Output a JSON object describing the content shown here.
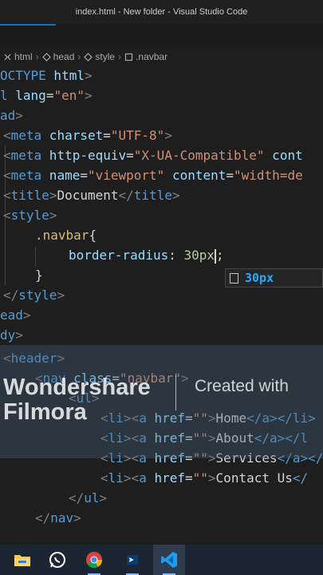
{
  "window": {
    "title": "index.html - New folder - Visual Studio Code"
  },
  "breadcrumb": [
    {
      "label": "html",
      "icon": "html-tag-icon"
    },
    {
      "label": "head",
      "icon": "html-tag-icon"
    },
    {
      "label": "style",
      "icon": "html-tag-icon"
    },
    {
      "label": ".navbar",
      "icon": "css-selector-icon"
    }
  ],
  "code": {
    "line1": {
      "a": "OCTYPE",
      "b": " html",
      "c": ">"
    },
    "line2": {
      "a": "l",
      "b": " lang",
      "c": "=",
      "d": "\"en\"",
      "e": ">"
    },
    "line3": {
      "a": "ad",
      "b": ">"
    },
    "line4": {
      "lt": "<",
      "tag": "meta",
      "attr": " charset",
      "eq": "=",
      "val": "\"UTF-8\"",
      "gt": ">"
    },
    "line5": {
      "lt": "<",
      "tag": "meta",
      "attr": " http-equiv",
      "eq": "=",
      "val": "\"X-UA-Compatible\"",
      "attr2": " cont"
    },
    "line6": {
      "lt": "<",
      "tag": "meta",
      "attr": " name",
      "eq": "=",
      "val": "\"viewport\"",
      "attr2": " content",
      "eq2": "=",
      "val2": "\"width=de"
    },
    "line7": {
      "lt": "<",
      "tag": "title",
      "gt": ">",
      "text": "Document",
      "close_lt": "</",
      "close_tag": "title",
      "close_gt": ">"
    },
    "line8": {
      "lt": "<",
      "tag": "style",
      "gt": ">"
    },
    "line9": {
      "selector": ".navbar",
      "brace": "{"
    },
    "line10": {
      "prop": "border-radius",
      "colon": ": ",
      "num": "30",
      "unit": "px",
      "semi": ";"
    },
    "line11": {
      "brace": "}"
    },
    "line12": {
      "lt": "</",
      "tag": "style",
      "gt": ">"
    },
    "line13": {
      "a": "ead",
      "b": ">"
    },
    "line14": {
      "a": "dy",
      "b": ">"
    },
    "line15": {
      "lt": "<",
      "tag": "header",
      "gt": ">"
    },
    "line16": {
      "lt": "<",
      "tag": "nav",
      "attr": " class",
      "eq": "=",
      "val": "\"navbar\"",
      "gt": ">"
    },
    "line17": {
      "lt": "<",
      "tag": "ul",
      "gt": ">"
    },
    "line18": {
      "lt": "<",
      "tag": "li",
      "gt": ">",
      "lt2": "<",
      "tag2": "a",
      "attr": " href",
      "eq": "=",
      "val": "\"\"",
      "gt2": ">",
      "text": "Home",
      "close": "</a></li>"
    },
    "line19": {
      "lt": "<",
      "tag": "li",
      "gt": ">",
      "lt2": "<",
      "tag2": "a",
      "attr": " href",
      "eq": "=",
      "val": "\"\"",
      "gt2": ">",
      "text": "About",
      "close": "</a></l"
    },
    "line20": {
      "lt": "<",
      "tag": "li",
      "gt": ">",
      "lt2": "<",
      "tag2": "a",
      "attr": " href",
      "eq": "=",
      "val": "\"\"",
      "gt2": ">",
      "text": "Services",
      "close": "</a></"
    },
    "line21": {
      "lt": "<",
      "tag": "li",
      "gt": ">",
      "lt2": "<",
      "tag2": "a",
      "attr": " href",
      "eq": "=",
      "val": "\"\"",
      "gt2": ">",
      "text": "Contact Us",
      "close": "</"
    },
    "line22": {
      "lt": "</",
      "tag": "ul",
      "gt": ">"
    },
    "line23": {
      "lt": "</",
      "tag": "nav",
      "gt": ">"
    }
  },
  "suggestion": {
    "label": "30px",
    "icon": "css-value-icon"
  },
  "watermark": {
    "brand_line1": "Wondershare",
    "brand_line2": "Filmora",
    "created": "Created with"
  },
  "taskbar": [
    {
      "icon": "file-explorer-icon"
    },
    {
      "icon": "whatsapp-icon"
    },
    {
      "icon": "chrome-icon"
    },
    {
      "icon": "app-icon"
    },
    {
      "icon": "vscode-icon"
    }
  ],
  "colors": {
    "accent": "#0e70c0",
    "tag": "#569cd6",
    "attribute": "#9cdcfe",
    "string": "#ce9178",
    "selector": "#d7ba7d"
  }
}
